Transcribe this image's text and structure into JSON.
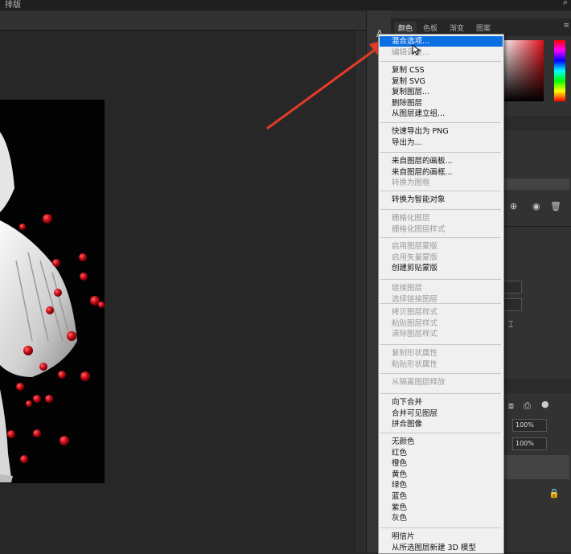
{
  "title_partial": "排版",
  "colors": {
    "accent": "#0a6fe0",
    "menu_bg": "#f0f0f0",
    "app_dark": "#282828"
  },
  "panel_tabs": [
    "颜色",
    "色板",
    "渐变",
    "图案"
  ],
  "zoom_opacity": "100%",
  "zoom_fill": "100%",
  "menu": {
    "groups": [
      [
        {
          "label": "混合选项...",
          "enabled": true,
          "highlighted": true
        },
        {
          "label": "编辑调整...",
          "enabled": false
        }
      ],
      [
        {
          "label": "复制 CSS",
          "enabled": true
        },
        {
          "label": "复制 SVG",
          "enabled": true
        },
        {
          "label": "复制图层...",
          "enabled": true
        },
        {
          "label": "删除图层",
          "enabled": true
        },
        {
          "label": "从图层建立组...",
          "enabled": true
        }
      ],
      [
        {
          "label": "快速导出为 PNG",
          "enabled": true
        },
        {
          "label": "导出为...",
          "enabled": true
        }
      ],
      [
        {
          "label": "来自图层的画板...",
          "enabled": true
        },
        {
          "label": "来自图层的画框...",
          "enabled": true
        },
        {
          "label": "转换为图框",
          "enabled": false
        }
      ],
      [
        {
          "label": "转换为智能对象",
          "enabled": true
        }
      ],
      [
        {
          "label": "栅格化图层",
          "enabled": false
        },
        {
          "label": "栅格化图层样式",
          "enabled": false
        }
      ],
      [
        {
          "label": "启用图层蒙版",
          "enabled": false
        },
        {
          "label": "启用矢量蒙版",
          "enabled": false
        },
        {
          "label": "创建剪贴蒙版",
          "enabled": true
        }
      ],
      [
        {
          "label": "链接图层",
          "enabled": false
        },
        {
          "label": "选择链接图层",
          "enabled": false
        }
      ],
      [
        {
          "label": "拷贝图层样式",
          "enabled": false
        },
        {
          "label": "粘贴图层样式",
          "enabled": false
        },
        {
          "label": "清除图层样式",
          "enabled": false
        }
      ],
      [
        {
          "label": "复制形状属性",
          "enabled": false
        },
        {
          "label": "粘贴形状属性",
          "enabled": false
        }
      ],
      [
        {
          "label": "从隔离图层释放",
          "enabled": false
        }
      ],
      [
        {
          "label": "向下合并",
          "enabled": true
        },
        {
          "label": "合并可见图层",
          "enabled": true
        },
        {
          "label": "拼合图像",
          "enabled": true
        }
      ],
      [
        {
          "label": "无颜色",
          "enabled": true
        },
        {
          "label": "红色",
          "enabled": true
        },
        {
          "label": "橙色",
          "enabled": true
        },
        {
          "label": "黄色",
          "enabled": true
        },
        {
          "label": "绿色",
          "enabled": true
        },
        {
          "label": "蓝色",
          "enabled": true
        },
        {
          "label": "紫色",
          "enabled": true
        },
        {
          "label": "灰色",
          "enabled": true
        }
      ],
      [
        {
          "label": "明信片",
          "enabled": true
        },
        {
          "label": "从所选图层新建 3D 模型",
          "enabled": true
        }
      ]
    ]
  }
}
